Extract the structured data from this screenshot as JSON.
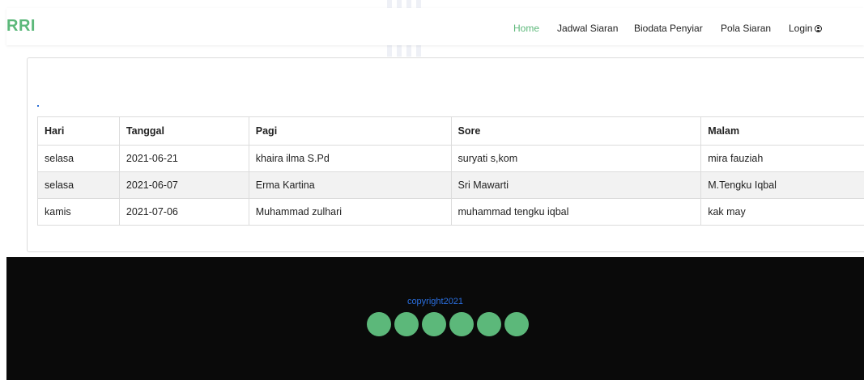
{
  "brand": {
    "name": "RRI",
    "color": "#5cb87a"
  },
  "nav": {
    "items": [
      {
        "label": "Home",
        "active": true
      },
      {
        "label": "Jadwal Siaran",
        "active": false
      },
      {
        "label": "Biodata Penyiar",
        "active": false
      },
      {
        "label": "Pola Siaran",
        "active": false
      },
      {
        "label": "Login",
        "active": false,
        "icon": "user-circle-icon"
      }
    ]
  },
  "table": {
    "headers": [
      "Hari",
      "Tanggal",
      "Pagi",
      "Sore",
      "Malam"
    ],
    "rows": [
      [
        "selasa",
        "2021-06-21",
        "khaira ilma S.Pd",
        "suryati s,kom",
        "mira fauziah"
      ],
      [
        "selasa",
        "2021-06-07",
        "Erma Kartina",
        "Sri Mawarti",
        "M.Tengku Iqbal"
      ],
      [
        "kamis",
        "2021-07-06",
        "Muhammad zulhari",
        "muhammad tengku iqbal",
        "kak may"
      ]
    ]
  },
  "footer": {
    "copyright": "copyright2021",
    "social_icons": [
      "social-icon-1",
      "social-icon-2",
      "social-icon-3",
      "social-icon-4",
      "social-icon-5",
      "social-icon-6"
    ],
    "icon_color": "#5cb87a"
  }
}
